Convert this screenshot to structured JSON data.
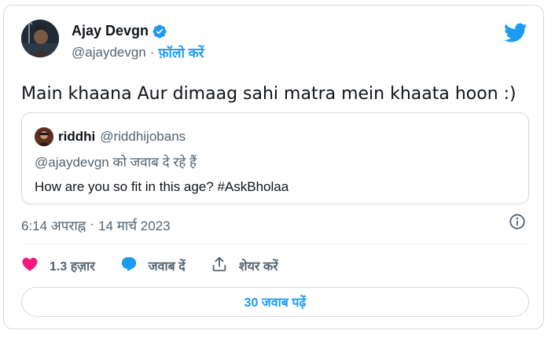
{
  "author": {
    "display_name": "Ajay Devgn",
    "handle": "@ajaydevgn",
    "separator": "·",
    "follow_label": "फ़ॉलो करें",
    "verified": true
  },
  "tweet": {
    "text": "Main khaana Aur dimaag sahi matra mein khaata hoon :)"
  },
  "quoted": {
    "display_name": "riddhi",
    "handle": "@riddhijobans",
    "reply_context": "@ajaydevgn को जवाब दे रहे हैं",
    "text": "How are you so fit in this age? #AskBholaa"
  },
  "meta": {
    "time": "6:14 अपराह्न",
    "separator": "·",
    "date": "14 मार्च 2023"
  },
  "actions": {
    "likes_label": "1.3 हज़ार",
    "reply_label": "जवाब दें",
    "share_label": "शेयर करें"
  },
  "read_replies_label": "30 जवाब पढ़ें",
  "colors": {
    "accent": "#1d9bf0",
    "like": "#f91880",
    "text_secondary": "#536471",
    "border": "#cfd9de"
  },
  "icons": [
    "avatar",
    "verified-badge-icon",
    "twitter-bird-icon",
    "info-icon",
    "heart-icon",
    "reply-bubble-icon",
    "share-icon"
  ]
}
